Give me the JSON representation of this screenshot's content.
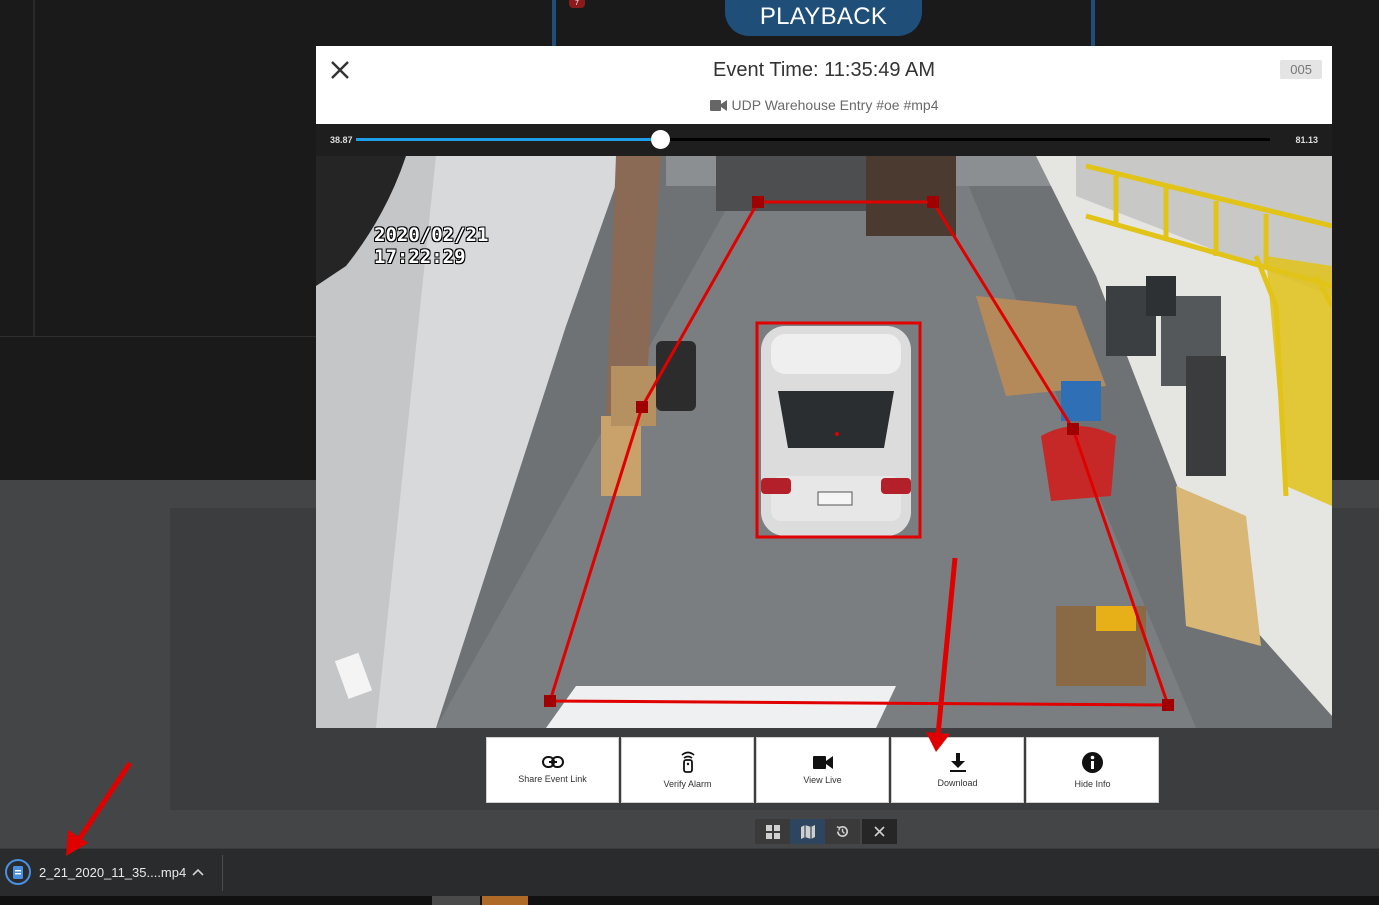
{
  "background": {
    "playback_label": "PLAYBACK",
    "badge": "7"
  },
  "modal": {
    "title": "Event Time: 11:35:49 AM",
    "camera": "UDP Warehouse Entry #oe #mp4",
    "camera_id": "005",
    "seek": {
      "start": "38.87",
      "end": "81.13",
      "progress": 0.333
    },
    "overlay": {
      "date": "2020/02/21",
      "time": "17:22:29"
    }
  },
  "actions": [
    {
      "label": "Share Event Link",
      "icon": "link-icon"
    },
    {
      "label": "Verify Alarm",
      "icon": "verify-alarm-icon"
    },
    {
      "label": "View Live",
      "icon": "video-camera-icon"
    },
    {
      "label": "Download",
      "icon": "download-icon"
    },
    {
      "label": "Hide Info",
      "icon": "info-icon"
    }
  ],
  "view_toggle": [
    "grid-icon",
    "map-icon",
    "history-icon",
    "close-icon"
  ],
  "download_bar": {
    "filename": "2_21_2020_11_35....mp4"
  },
  "colors": {
    "accent_blue": "#1f4e79",
    "seek_fill": "#1e9ee8",
    "detection_red": "#e00000"
  }
}
